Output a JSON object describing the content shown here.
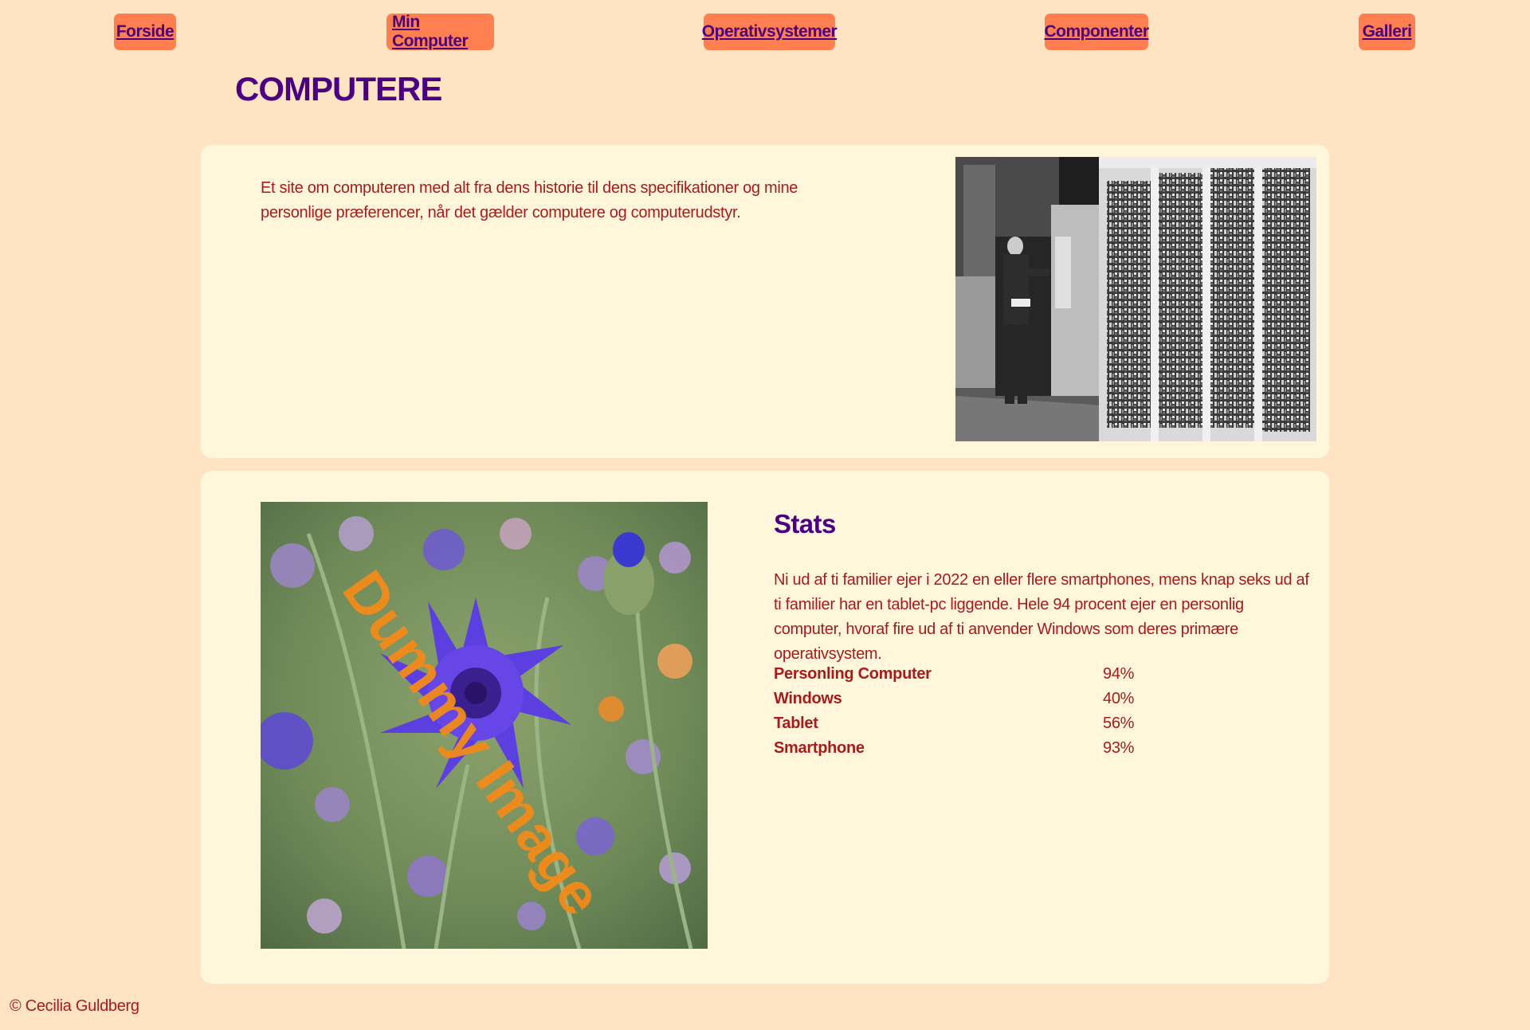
{
  "nav": {
    "items": [
      {
        "label": "Forside"
      },
      {
        "label": "Min Computer"
      },
      {
        "label": "Operativsystemer"
      },
      {
        "label": "Componenter"
      },
      {
        "label": "Galleri"
      }
    ]
  },
  "header": {
    "title": "COMPUTERE"
  },
  "intro": {
    "text": "Et site om computeren med alt fra dens historie til dens specifikationer og mine personlige præferencer, når det gælder computere og computerudstyr.",
    "image": {
      "icon": "vintage-computer-photo"
    }
  },
  "stats": {
    "image": {
      "icon": "cornflower-photo",
      "watermark": "Dummy Image"
    },
    "title": "Stats",
    "text": "Ni ud af ti familier ejer i 2022 en eller flere smartphones, mens knap seks ud af ti familier har en tablet-pc liggende. Hele 94 procent ejer en personlig computer, hvoraf fire ud af ti anvender Windows som deres primære operativsystem.",
    "rows": [
      {
        "label": "Personling Computer",
        "value": "94%"
      },
      {
        "label": "Windows",
        "value": "40%"
      },
      {
        "label": "Tablet",
        "value": "56%"
      },
      {
        "label": "Smartphone",
        "value": "93%"
      }
    ]
  },
  "footer": {
    "text": "© Cecilia Guldberg"
  },
  "colors": {
    "background": "#ffe4c4",
    "card": "#fff6dc",
    "nav_button": "#ff7f50",
    "heading": "#4b0082",
    "text": "#a61b1b",
    "watermark": "#f28a1a"
  }
}
